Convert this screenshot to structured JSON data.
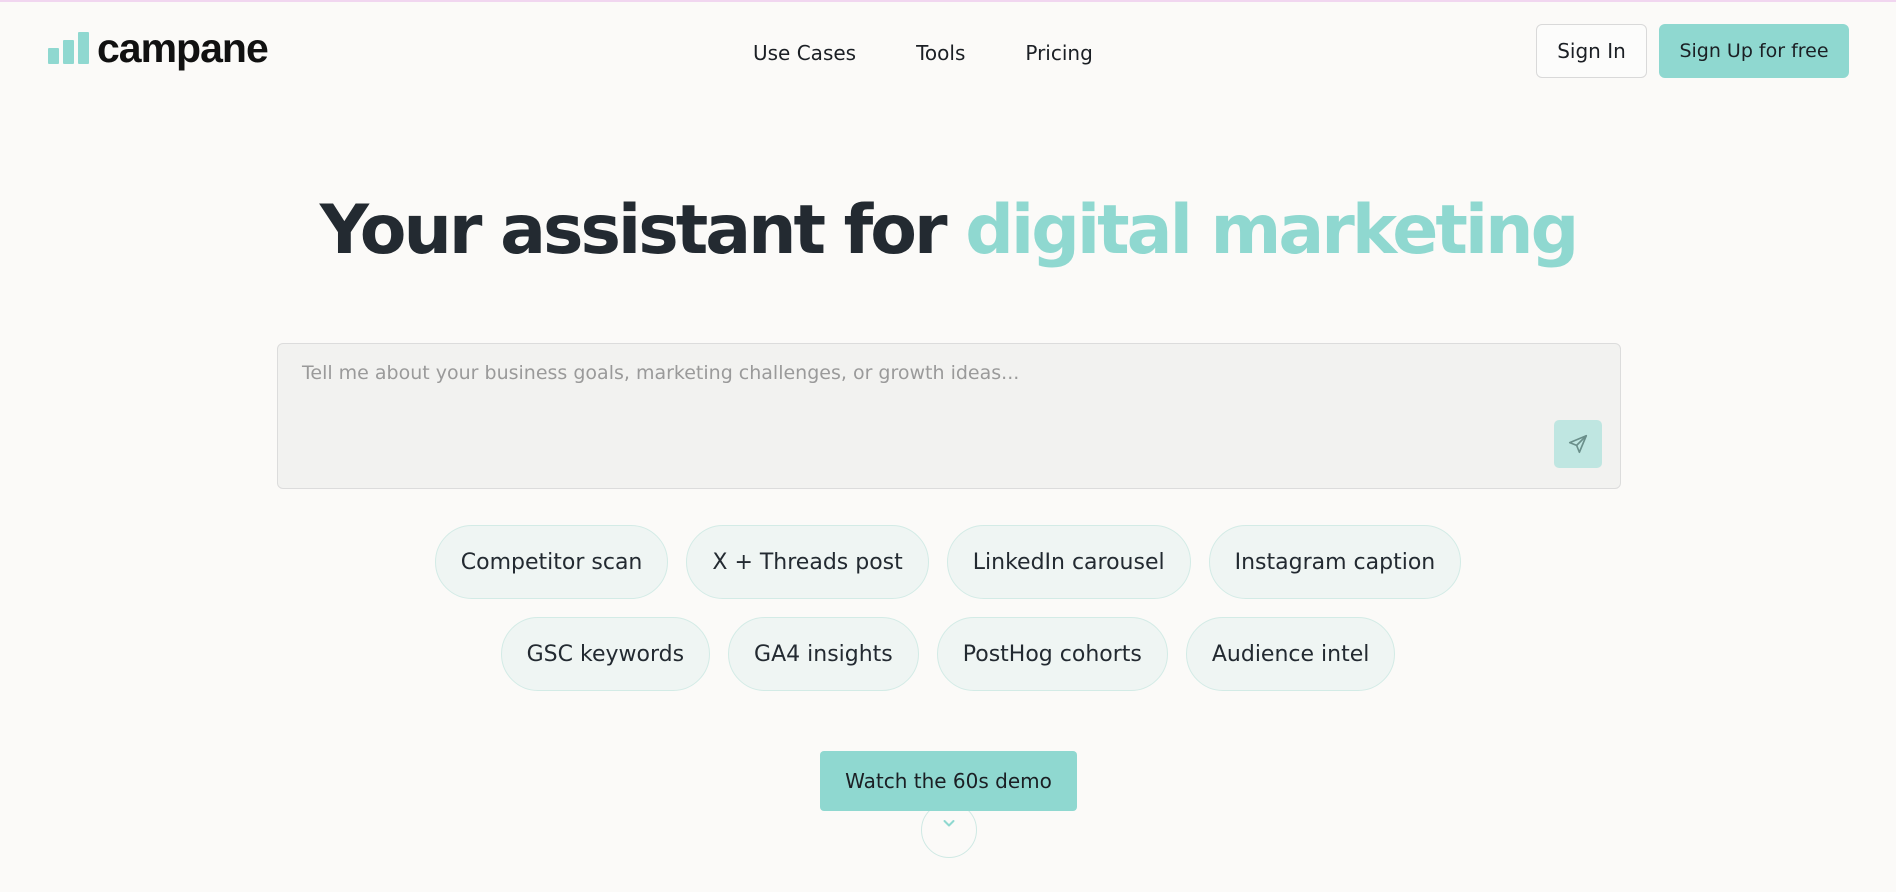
{
  "brand": {
    "name": "campane",
    "accent_color": "#8fd8d0"
  },
  "nav": {
    "items": [
      {
        "label": "Use Cases"
      },
      {
        "label": "Tools"
      },
      {
        "label": "Pricing"
      }
    ]
  },
  "auth": {
    "signin_label": "Sign In",
    "signup_label": "Sign Up for free"
  },
  "hero": {
    "title_main": "Your assistant for ",
    "title_accent": "digital marketing"
  },
  "prompt": {
    "placeholder": "Tell me about your business goals, marketing challenges, or growth ideas...",
    "value": "",
    "send_icon": "send-icon"
  },
  "chips": {
    "row1": [
      {
        "label": "Competitor scan"
      },
      {
        "label": "X + Threads post"
      },
      {
        "label": "LinkedIn carousel"
      },
      {
        "label": "Instagram caption"
      }
    ],
    "row2": [
      {
        "label": "GSC keywords"
      },
      {
        "label": "GA4 insights"
      },
      {
        "label": "PostHog cohorts"
      },
      {
        "label": "Audience intel"
      }
    ]
  },
  "cta": {
    "demo_label": "Watch the 60s demo",
    "scroll_icon": "chevron-down-icon"
  }
}
